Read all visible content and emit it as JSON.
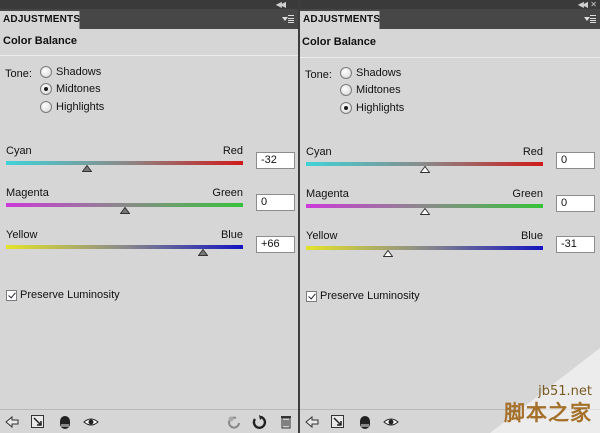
{
  "colors": {
    "panel_bg": "#d6d6d6",
    "cyan": "#3fd3d8",
    "red": "#d01a1a",
    "magenta": "#cc3ad8",
    "green": "#36c23a",
    "yellow": "#e3e32a",
    "blue": "#1414c0"
  },
  "panels": [
    {
      "tab_label": "ADJUSTMENTS",
      "title": "Color Balance",
      "tone": {
        "label": "Tone:",
        "options": [
          "Shadows",
          "Midtones",
          "Highlights"
        ],
        "selected": "Midtones"
      },
      "sliders": [
        {
          "left": "Cyan",
          "right": "Red",
          "value": "-32",
          "level": -32,
          "thumb": "solid"
        },
        {
          "left": "Magenta",
          "right": "Green",
          "value": "0",
          "level": 0,
          "thumb": "solid"
        },
        {
          "left": "Yellow",
          "right": "Blue",
          "value": "+66",
          "level": 66,
          "thumb": "solid"
        }
      ],
      "preserve": {
        "label": "Preserve Luminosity",
        "checked": true
      },
      "bottom_icons": [
        "back-arrow-icon",
        "clip-to-layer-icon",
        "layer-mask-icon",
        "eye-icon",
        "previous-state-icon",
        "reset-icon",
        "trash-icon"
      ]
    },
    {
      "tab_label": "ADJUSTMENTS",
      "title": "Color Balance",
      "tone": {
        "label": "Tone:",
        "options": [
          "Shadows",
          "Midtones",
          "Highlights"
        ],
        "selected": "Highlights"
      },
      "sliders": [
        {
          "left": "Cyan",
          "right": "Red",
          "value": "0",
          "level": 0,
          "thumb": "outline"
        },
        {
          "left": "Magenta",
          "right": "Green",
          "value": "0",
          "level": 0,
          "thumb": "outline"
        },
        {
          "left": "Yellow",
          "right": "Blue",
          "value": "-31",
          "level": -31,
          "thumb": "outline"
        }
      ],
      "preserve": {
        "label": "Preserve Luminosity",
        "checked": true
      },
      "bottom_icons": [
        "back-arrow-icon",
        "clip-to-layer-icon",
        "layer-mask-icon",
        "eye-icon"
      ]
    }
  ],
  "watermark": {
    "site": "jb51.net",
    "name": "脚本之家"
  }
}
